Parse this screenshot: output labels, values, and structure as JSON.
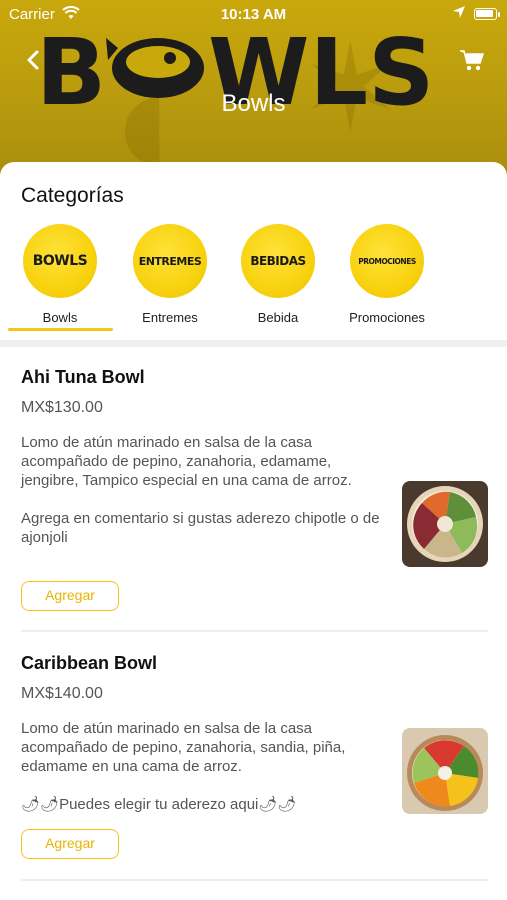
{
  "status_bar": {
    "carrier": "Carrier",
    "time": "10:13 AM"
  },
  "header": {
    "logo_text": "BOWLS",
    "title": "Bowls",
    "back_icon": "chevron-left-icon",
    "cart_icon": "cart-icon"
  },
  "categories": {
    "title": "Categorías",
    "items": [
      {
        "badge": "BOWLS",
        "label": "Bowls",
        "selected": true
      },
      {
        "badge": "ENTREMES",
        "label": "Entremes",
        "selected": false
      },
      {
        "badge": "BEBIDAS",
        "label": "Bebida",
        "selected": false
      },
      {
        "badge": "PROMOCIONES",
        "label": "Promociones",
        "selected": false
      }
    ]
  },
  "products": [
    {
      "name": "Ahi Tuna Bowl",
      "price": "MX$130.00",
      "description": "Lomo de atún marinado en salsa de la casa acompañado de pepino, zanahoria, edamame, jengibre, Tampico especial en una cama de arroz.\n\nAgrega en comentario si gustas aderezo chipotle o de ajonjoli",
      "button": "Agregar"
    },
    {
      "name": "Caribbean Bowl",
      "price": "MX$140.00",
      "description": "Lomo de atún marinado en salsa de la casa acompañado de pepino, zanahoria, sandia, piña, edamame en una cama de arroz.\n\n🌶🌶Puedes elegir tu aderezo aqui🌶🌶",
      "button": "Agregar"
    }
  ],
  "colors": {
    "accent": "#f5c518",
    "header_bg": "#b89a0e"
  }
}
